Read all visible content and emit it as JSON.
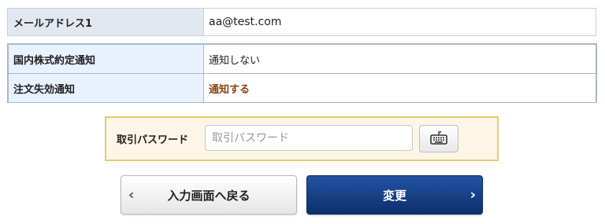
{
  "email": {
    "label": "メールアドレス1",
    "value": "aa@test.com"
  },
  "notifications": [
    {
      "label": "国内株式約定通知",
      "value": "通知しない",
      "highlight": false
    },
    {
      "label": "注文失効通知",
      "value": "通知する",
      "highlight": true
    }
  ],
  "password": {
    "label": "取引パスワード",
    "placeholder": "取引パスワード",
    "value": "",
    "keyboard_icon": "keyboard-icon"
  },
  "buttons": {
    "back_label": "入力画面へ戻る",
    "back_icon": "chevron-left-icon",
    "submit_label": "変更",
    "submit_icon": "chevron-right-icon"
  },
  "colors": {
    "submit_bg": "#0d2f6b",
    "highlight_text": "#8b4513",
    "password_box_border": "#e9c872",
    "password_box_bg": "#fdf6e6"
  }
}
